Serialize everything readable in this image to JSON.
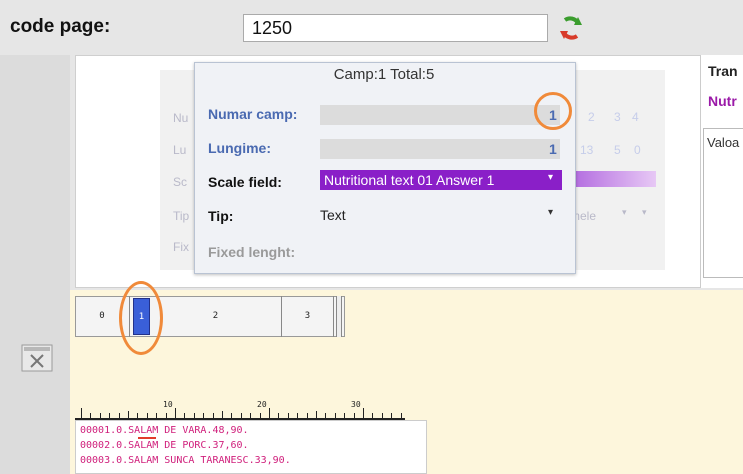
{
  "header": {
    "code_page_label": "code page:",
    "code_page_value": "1250"
  },
  "right_panel": {
    "title": "Tran",
    "subtitle": "Nutr",
    "box_label": "Valoa"
  },
  "background_form": {
    "labels": [
      "Nu",
      "Lu",
      "Sc",
      "Tip",
      "Fix"
    ],
    "numar_values": [
      "2",
      "3",
      "4"
    ],
    "lungime_values": [
      "13",
      "5",
      "0"
    ],
    "tip_value": "mele"
  },
  "popup": {
    "title": "Camp:1  Total:5",
    "numar_label": "Numar camp:",
    "numar_value": "1",
    "lungime_label": "Lungime:",
    "lungime_value": "1",
    "scale_label": "Scale field:",
    "scale_value": "Nutritional text 01 Answer 1",
    "tip_label": "Tip:",
    "tip_value": "Text",
    "fixed_label": "Fixed lenght:"
  },
  "tabs": [
    "0",
    "1",
    "2",
    "3"
  ],
  "active_tab": "1",
  "ruler": {
    "labels": [
      "10",
      "20",
      "30"
    ]
  },
  "text_lines": [
    "00001.0.SALAM DE VARA.48,90.",
    "00002.0.SALAM DE PORC.37,60.",
    "00003.0.SALAM SUNCA TARANESC.33,90."
  ],
  "colors": {
    "scale_purple": "#8a1fc8",
    "label_blue": "#4a6ab1",
    "highlight_orange": "#f08a3a",
    "text_magenta": "#d0207c",
    "active_tab_blue": "#3a5fd8"
  },
  "icons": [
    "refresh-icon",
    "calculator-icon"
  ]
}
